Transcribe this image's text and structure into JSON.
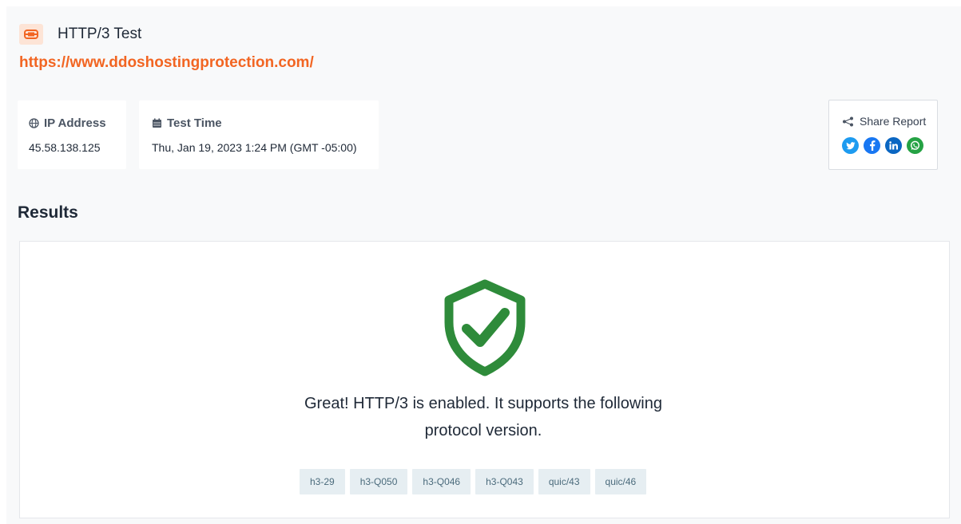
{
  "header": {
    "icon": "http-server-icon",
    "title": "HTTP/3 Test",
    "url": "https://www.ddoshostingprotection.com/"
  },
  "info": {
    "ip_label": "IP Address",
    "ip_value": "45.58.138.125",
    "time_label": "Test Time",
    "time_value": "Thu, Jan 19, 2023 1:24 PM (GMT -05:00)"
  },
  "share": {
    "label": "Share Report",
    "networks": [
      "twitter",
      "facebook",
      "linkedin",
      "whatsapp"
    ]
  },
  "results": {
    "heading": "Results",
    "message_line1": "Great! HTTP/3 is enabled. It supports the following",
    "message_line2": "protocol version.",
    "protocols": [
      "h3-29",
      "h3-Q050",
      "h3-Q046",
      "h3-Q043",
      "quic/43",
      "quic/46"
    ]
  },
  "colors": {
    "accent": "#f26522",
    "success": "#2e8b3a",
    "twitter": "#1d9bf0",
    "facebook": "#1877f2",
    "linkedin": "#0a66c2",
    "whatsapp": "#25a244"
  }
}
